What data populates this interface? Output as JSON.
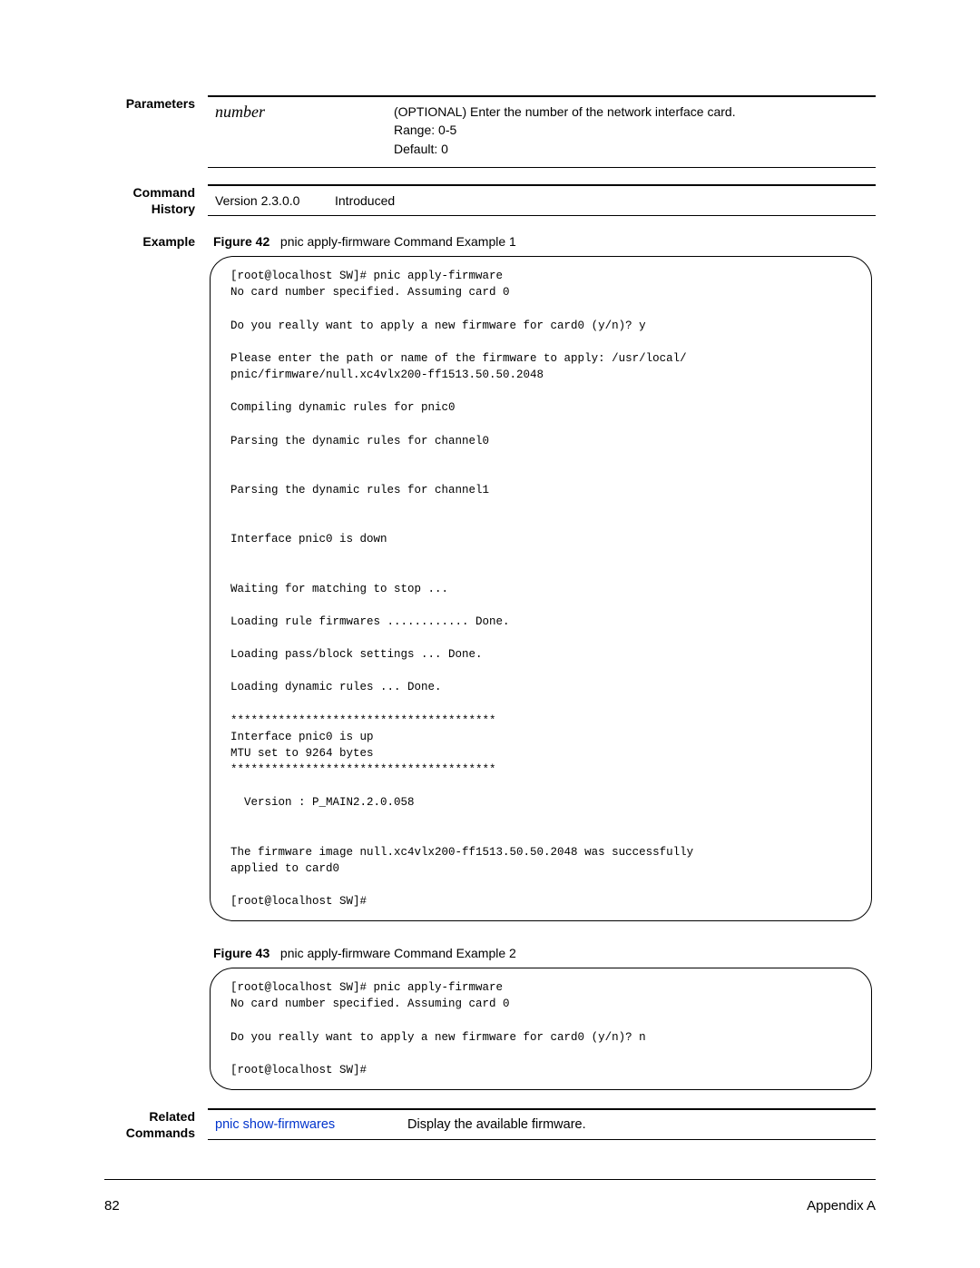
{
  "parameters": {
    "label": "Parameters",
    "name": "number",
    "desc": "(OPTIONAL) Enter the number of the network interface card.\nRange: 0-5\nDefault: 0"
  },
  "history": {
    "label": "Command History",
    "version": "Version 2.3.0.0",
    "status": "Introduced"
  },
  "example": {
    "label": "Example",
    "fig1_prefix": "Figure 42",
    "fig1_title": "pnic apply-firmware Command Example 1",
    "fig1_code": "[root@localhost SW]# pnic apply-firmware\nNo card number specified. Assuming card 0\n\nDo you really want to apply a new firmware for card0 (y/n)? y\n\nPlease enter the path or name of the firmware to apply: /usr/local/\npnic/firmware/null.xc4vlx200-ff1513.50.50.2048\n\nCompiling dynamic rules for pnic0\n\nParsing the dynamic rules for channel0\n\n\nParsing the dynamic rules for channel1\n\n\nInterface pnic0 is down\n\n\nWaiting for matching to stop ...\n\nLoading rule firmwares ............ Done.\n\nLoading pass/block settings ... Done.\n\nLoading dynamic rules ... Done.\n\n***************************************\nInterface pnic0 is up\nMTU set to 9264 bytes\n***************************************\n\n  Version : P_MAIN2.2.0.058\n\n\nThe firmware image null.xc4vlx200-ff1513.50.50.2048 was successfully \napplied to card0\n\n[root@localhost SW]#",
    "fig2_prefix": "Figure 43",
    "fig2_title": "pnic apply-firmware Command Example 2",
    "fig2_code": "[root@localhost SW]# pnic apply-firmware\nNo card number specified. Assuming card 0\n\nDo you really want to apply a new firmware for card0 (y/n)? n\n\n[root@localhost SW]#"
  },
  "related": {
    "label": "Related Commands",
    "cmd": "pnic show-firmwares",
    "desc": "Display the available firmware."
  },
  "footer": {
    "page": "82",
    "appendix": "Appendix A"
  }
}
